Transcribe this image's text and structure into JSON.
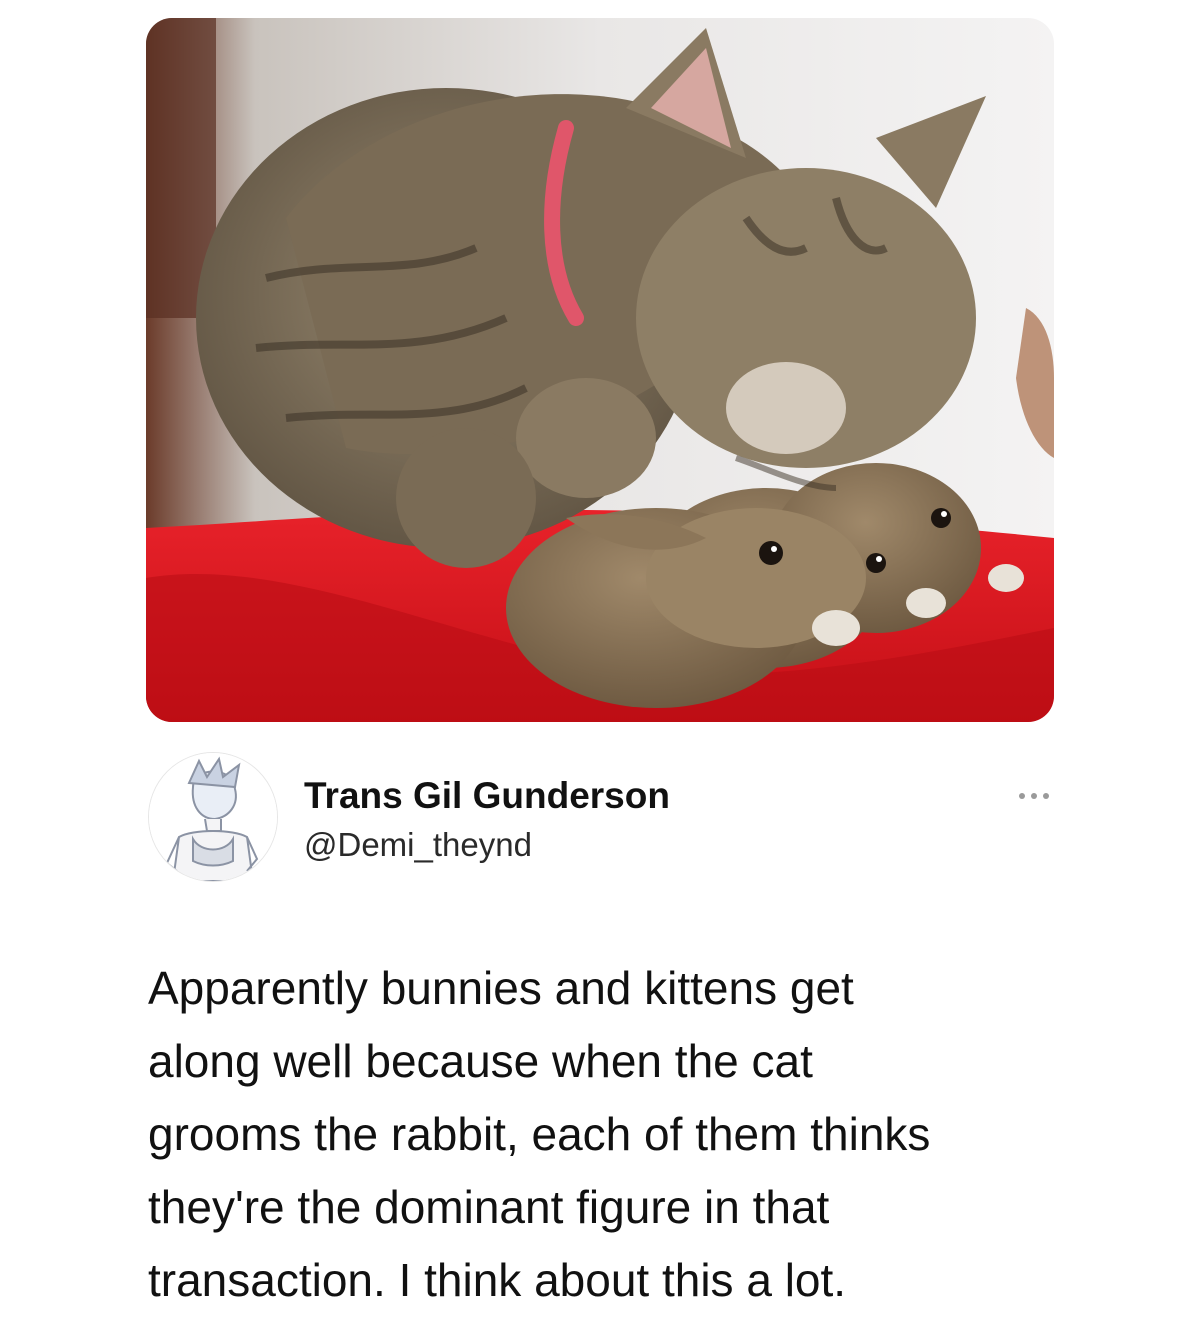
{
  "tweet": {
    "media": {
      "icon": "photo-cat-grooming-bunnies"
    },
    "author": {
      "display_name": "Trans Gil Gunderson",
      "handle": "@Demi_theynd",
      "avatar_icon": "anime-avatar"
    },
    "more_icon": "more-options-icon",
    "text_lines": [
      "Apparently bunnies and kittens get",
      "along well because when the cat",
      "grooms the rabbit, each of them thinks",
      "they're the dominant figure in that",
      "transaction. I think about this a lot."
    ]
  },
  "colors": {
    "text": "#111111",
    "background": "#ffffff",
    "blanket": "#d9161c"
  }
}
